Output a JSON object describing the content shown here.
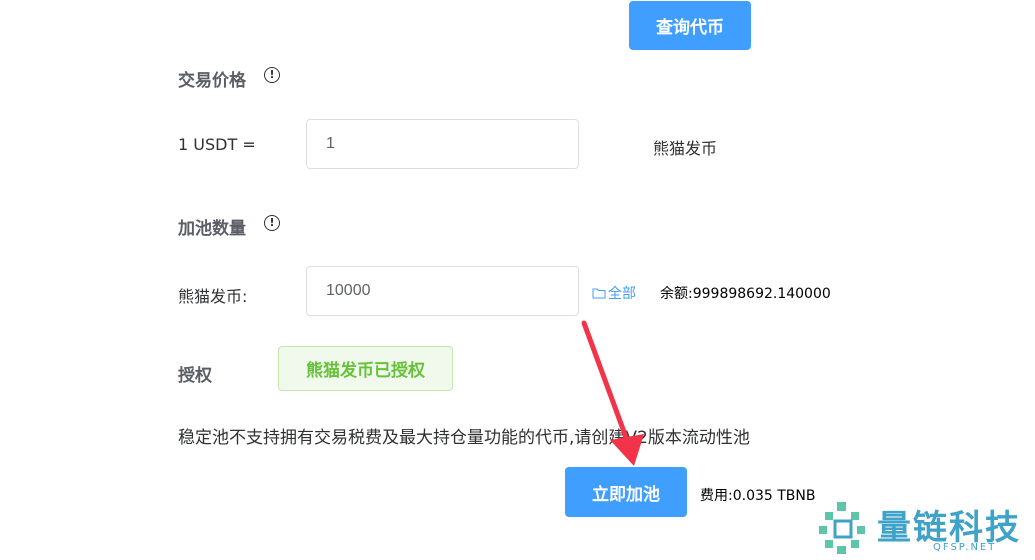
{
  "buttons": {
    "query_token": "查询代币",
    "add_pool": "立即加池"
  },
  "price_section": {
    "title": "交易价格",
    "base_label": "1 USDT =",
    "price_value": "1",
    "quote_token": "熊猫发币"
  },
  "amount_section": {
    "title": "加池数量",
    "token_label": "熊猫发币:",
    "amount_value": "10000",
    "all_link": "全部",
    "balance": "余额:999898692.140000"
  },
  "auth_section": {
    "title": "授权",
    "status": "熊猫发币已授权"
  },
  "notice": "稳定池不支持拥有交易税费及最大持仓量功能的代币,请创建V2版本流动性池",
  "fee": "费用:0.035 TBNB",
  "watermark": {
    "brand": "量链科技",
    "domain": "QFSP.NET"
  },
  "colors": {
    "primary": "#409eff",
    "success": "#67c23a",
    "arrow": "#f2334a",
    "watermark": "#3fa2c8"
  }
}
